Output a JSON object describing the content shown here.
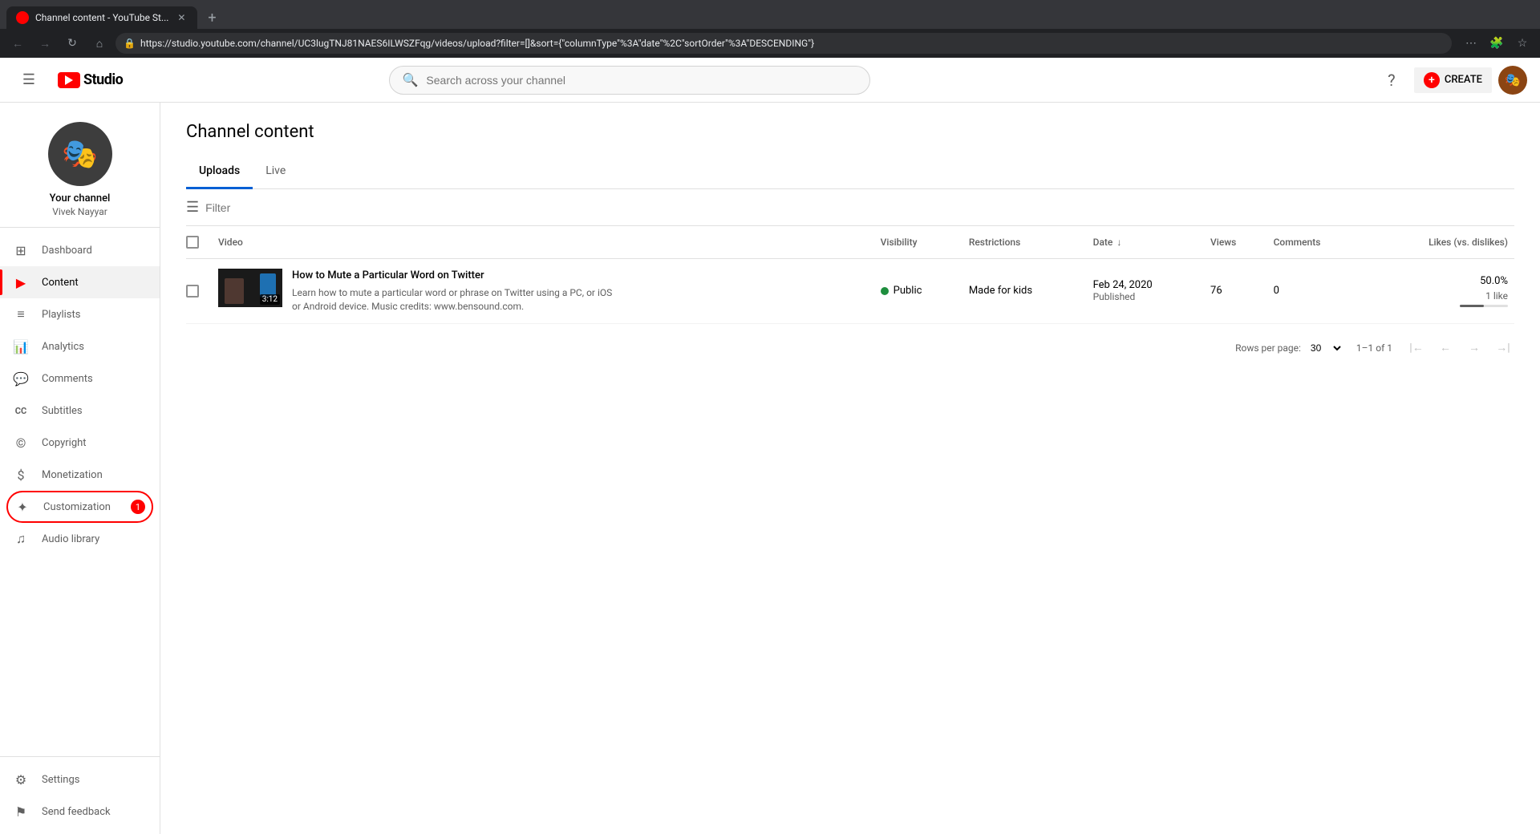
{
  "browser": {
    "tab_title": "Channel content - YouTube St...",
    "url": "https://studio.youtube.com/channel/UC3lugTNJ81NAES6ILWSZFqg/videos/upload?filter=[]&sort={\"columnType\"%3A\"date\"%2C\"sortOrder\"%3A\"DESCENDING\"}",
    "new_tab_icon": "+"
  },
  "topnav": {
    "logo_text": "Studio",
    "search_placeholder": "Search across your channel",
    "help_icon": "?",
    "create_label": "CREATE",
    "menu_icon": "☰"
  },
  "sidebar": {
    "channel_name": "Your channel",
    "channel_handle": "Vivek Nayyar",
    "nav_items": [
      {
        "id": "dashboard",
        "label": "Dashboard",
        "icon": "⊞"
      },
      {
        "id": "content",
        "label": "Content",
        "icon": "▶",
        "active": true
      },
      {
        "id": "playlists",
        "label": "Playlists",
        "icon": "☰"
      },
      {
        "id": "analytics",
        "label": "Analytics",
        "icon": "📊"
      },
      {
        "id": "comments",
        "label": "Comments",
        "icon": "💬"
      },
      {
        "id": "subtitles",
        "label": "Subtitles",
        "icon": "CC"
      },
      {
        "id": "copyright",
        "label": "Copyright",
        "icon": "©"
      },
      {
        "id": "monetization",
        "label": "Monetization",
        "icon": "$"
      },
      {
        "id": "customization",
        "label": "Customization",
        "icon": "✦",
        "badge": "1"
      },
      {
        "id": "audio-library",
        "label": "Audio library",
        "icon": "♫"
      }
    ],
    "bottom_items": [
      {
        "id": "settings",
        "label": "Settings",
        "icon": "⚙"
      },
      {
        "id": "send-feedback",
        "label": "Send feedback",
        "icon": "⚑"
      }
    ]
  },
  "content": {
    "page_title": "Channel content",
    "tabs": [
      {
        "id": "uploads",
        "label": "Uploads",
        "active": true
      },
      {
        "id": "live",
        "label": "Live",
        "active": false
      }
    ],
    "filter_placeholder": "Filter",
    "table": {
      "columns": [
        {
          "id": "checkbox",
          "label": ""
        },
        {
          "id": "video",
          "label": "Video"
        },
        {
          "id": "visibility",
          "label": "Visibility"
        },
        {
          "id": "restrictions",
          "label": "Restrictions"
        },
        {
          "id": "date",
          "label": "Date",
          "sortable": true,
          "sort_dir": "desc"
        },
        {
          "id": "views",
          "label": "Views"
        },
        {
          "id": "comments",
          "label": "Comments"
        },
        {
          "id": "likes",
          "label": "Likes (vs. dislikes)"
        }
      ],
      "rows": [
        {
          "id": "row1",
          "title": "How to Mute a Particular Word on Twitter",
          "description": "Learn how to mute a particular word or phrase on Twitter using a PC, or iOS or Android device. Music credits: www.bensound.com.",
          "duration": "3:12",
          "visibility": "Public",
          "visibility_type": "public",
          "restrictions": "Made for kids",
          "date_primary": "Feb 24, 2020",
          "date_secondary": "Published",
          "views": "76",
          "comments": "0",
          "likes_percent": "50.0%",
          "likes_count": "1 like",
          "likes_bar_width": "50"
        }
      ]
    },
    "pagination": {
      "rows_per_page_label": "Rows per page:",
      "rows_per_page_value": "30",
      "page_info": "1–1 of 1"
    }
  }
}
